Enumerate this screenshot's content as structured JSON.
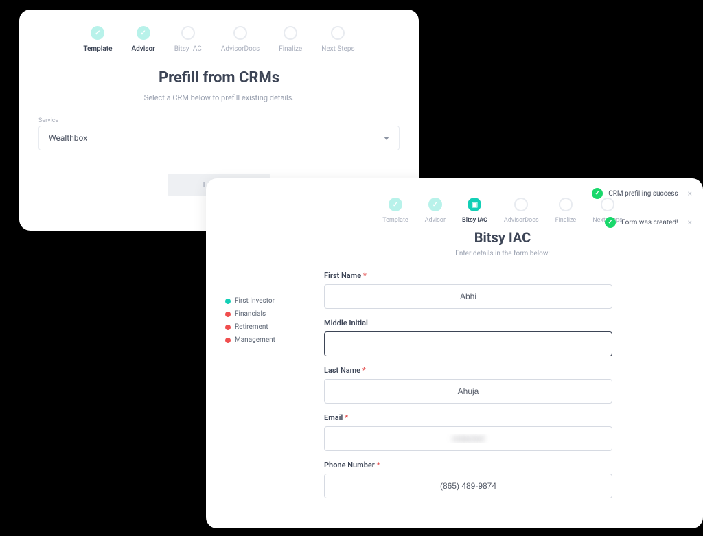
{
  "back": {
    "stepper": [
      {
        "label": "Template",
        "state": "done"
      },
      {
        "label": "Advisor",
        "state": "done"
      },
      {
        "label": "Bitsy IAC",
        "state": "empty"
      },
      {
        "label": "AdvisorDocs",
        "state": "empty"
      },
      {
        "label": "Finalize",
        "state": "empty"
      },
      {
        "label": "Next Steps",
        "state": "empty"
      }
    ],
    "title": "Prefill from CRMs",
    "subtitle": "Select a CRM below to prefill existing details.",
    "service_label": "Service",
    "service_value": "Wealthbox",
    "loading": "Loading…"
  },
  "front": {
    "stepper": [
      {
        "label": "Template",
        "state": "done"
      },
      {
        "label": "Advisor",
        "state": "done"
      },
      {
        "label": "Bitsy IAC",
        "state": "current"
      },
      {
        "label": "AdvisorDocs",
        "state": "empty"
      },
      {
        "label": "Finalize",
        "state": "empty"
      },
      {
        "label": "Next Steps",
        "state": "empty"
      }
    ],
    "title": "Bitsy IAC",
    "subtitle": "Enter details in the form below:",
    "legend": [
      {
        "label": "First Investor",
        "color": "teal"
      },
      {
        "label": "Financials",
        "color": "red"
      },
      {
        "label": "Retirement",
        "color": "red"
      },
      {
        "label": "Management",
        "color": "red"
      }
    ],
    "fields": {
      "first_name": {
        "label": "First Name",
        "required": true,
        "value": "Abhi"
      },
      "middle_initial": {
        "label": "Middle Initial",
        "required": false,
        "value": ""
      },
      "last_name": {
        "label": "Last Name",
        "required": true,
        "value": "Ahuja"
      },
      "email": {
        "label": "Email",
        "required": true,
        "value": "redacted"
      },
      "phone": {
        "label": "Phone Number",
        "required": true,
        "value": "(865) 489-9874"
      }
    },
    "toasts": [
      {
        "message": "CRM prefilling success"
      },
      {
        "message": "Form was created!"
      }
    ],
    "toast_close": "×"
  },
  "required_mark": "*"
}
